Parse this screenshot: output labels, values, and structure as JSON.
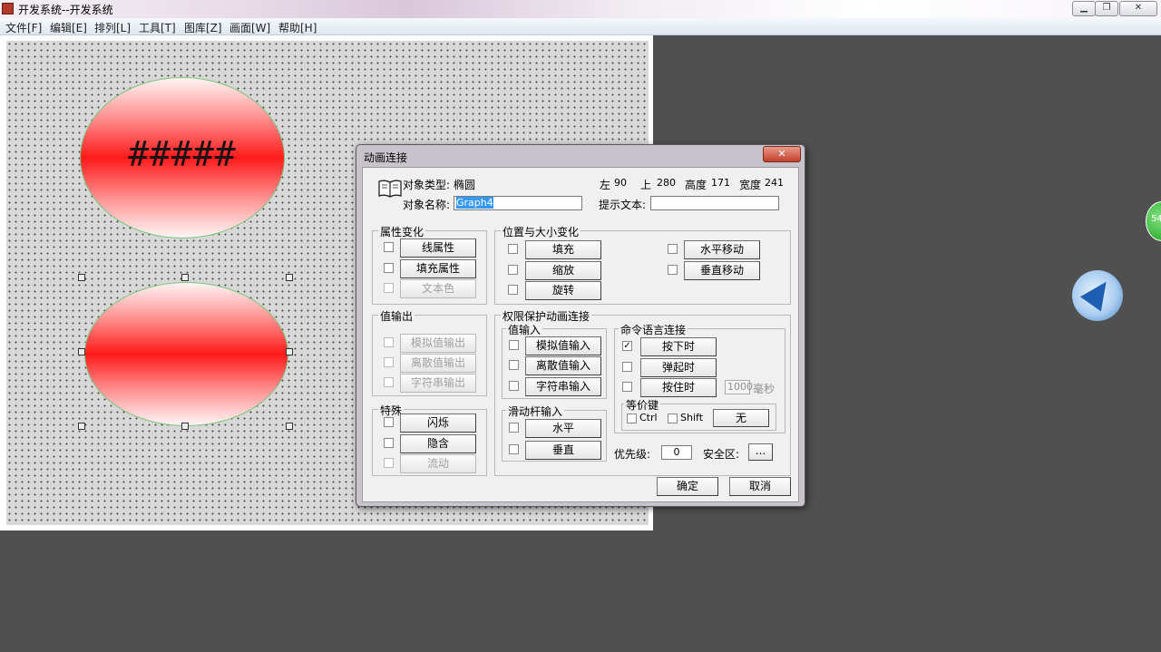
{
  "window": {
    "title": "开发系统--开发系统",
    "controls": {
      "minimize": "▁",
      "maximize": "❐",
      "close": "✕"
    }
  },
  "menu": [
    "文件[F]",
    "编辑[E]",
    "排列[L]",
    "工具[T]",
    "图库[Z]",
    "画面[W]",
    "帮助[H]"
  ],
  "canvas": {
    "top_ellipse_text": "#####"
  },
  "floating": {
    "badge_text": "54"
  },
  "dialog": {
    "title": "动画连接",
    "close": "✕",
    "object_type_label": "对象类型:",
    "object_type_value": "椭圆",
    "object_name_label": "对象名称:",
    "object_name_value": "Graph4",
    "left_label": "左",
    "left_value": "90",
    "top_label": "上",
    "top_value": "280",
    "height_label": "高度",
    "height_value": "171",
    "width_label": "宽度",
    "width_value": "241",
    "tooltip_label": "提示文本:",
    "tooltip_value": "",
    "attr_group": {
      "title": "属性变化",
      "items": [
        {
          "label": "线属性",
          "enabled": true
        },
        {
          "label": "填充属性",
          "enabled": true
        },
        {
          "label": "文本色",
          "enabled": false
        }
      ]
    },
    "pos_group": {
      "title": "位置与大小变化",
      "items": [
        {
          "label": "填充",
          "enabled": true
        },
        {
          "label": "缩放",
          "enabled": true
        },
        {
          "label": "旋转",
          "enabled": true
        },
        {
          "label": "水平移动",
          "enabled": true
        },
        {
          "label": "垂直移动",
          "enabled": true
        }
      ]
    },
    "valout_group": {
      "title": "值输出",
      "items": [
        {
          "label": "模拟值输出",
          "enabled": false
        },
        {
          "label": "离散值输出",
          "enabled": false
        },
        {
          "label": "字符串输出",
          "enabled": false
        }
      ]
    },
    "special_group": {
      "title": "特殊",
      "items": [
        {
          "label": "闪烁",
          "enabled": true
        },
        {
          "label": "隐含",
          "enabled": true
        },
        {
          "label": "流动",
          "enabled": false
        }
      ]
    },
    "perm_group": {
      "title": "权限保护动画连接"
    },
    "valin_group": {
      "title": "值输入",
      "items": [
        {
          "label": "模拟值输入",
          "enabled": true
        },
        {
          "label": "离散值输入",
          "enabled": true
        },
        {
          "label": "字符串输入",
          "enabled": true
        }
      ]
    },
    "slider_group": {
      "title": "滑动杆输入",
      "items": [
        {
          "label": "水平",
          "enabled": true
        },
        {
          "label": "垂直",
          "enabled": true
        }
      ]
    },
    "cmd_group": {
      "title": "命令语言连接",
      "items": [
        {
          "label": "按下时",
          "checked": true
        },
        {
          "label": "弹起时",
          "checked": false
        },
        {
          "label": "按住时",
          "checked": false
        }
      ],
      "hold_ms_value": "1000",
      "hold_ms_unit": "毫秒"
    },
    "hotkey_group": {
      "title": "等价键",
      "ctrl_label": "Ctrl",
      "shift_label": "Shift",
      "key_value": "无"
    },
    "priority_label": "优先级:",
    "priority_value": "0",
    "security_label": "安全区:",
    "security_button": "...",
    "ok_button": "确定",
    "cancel_button": "取消"
  }
}
